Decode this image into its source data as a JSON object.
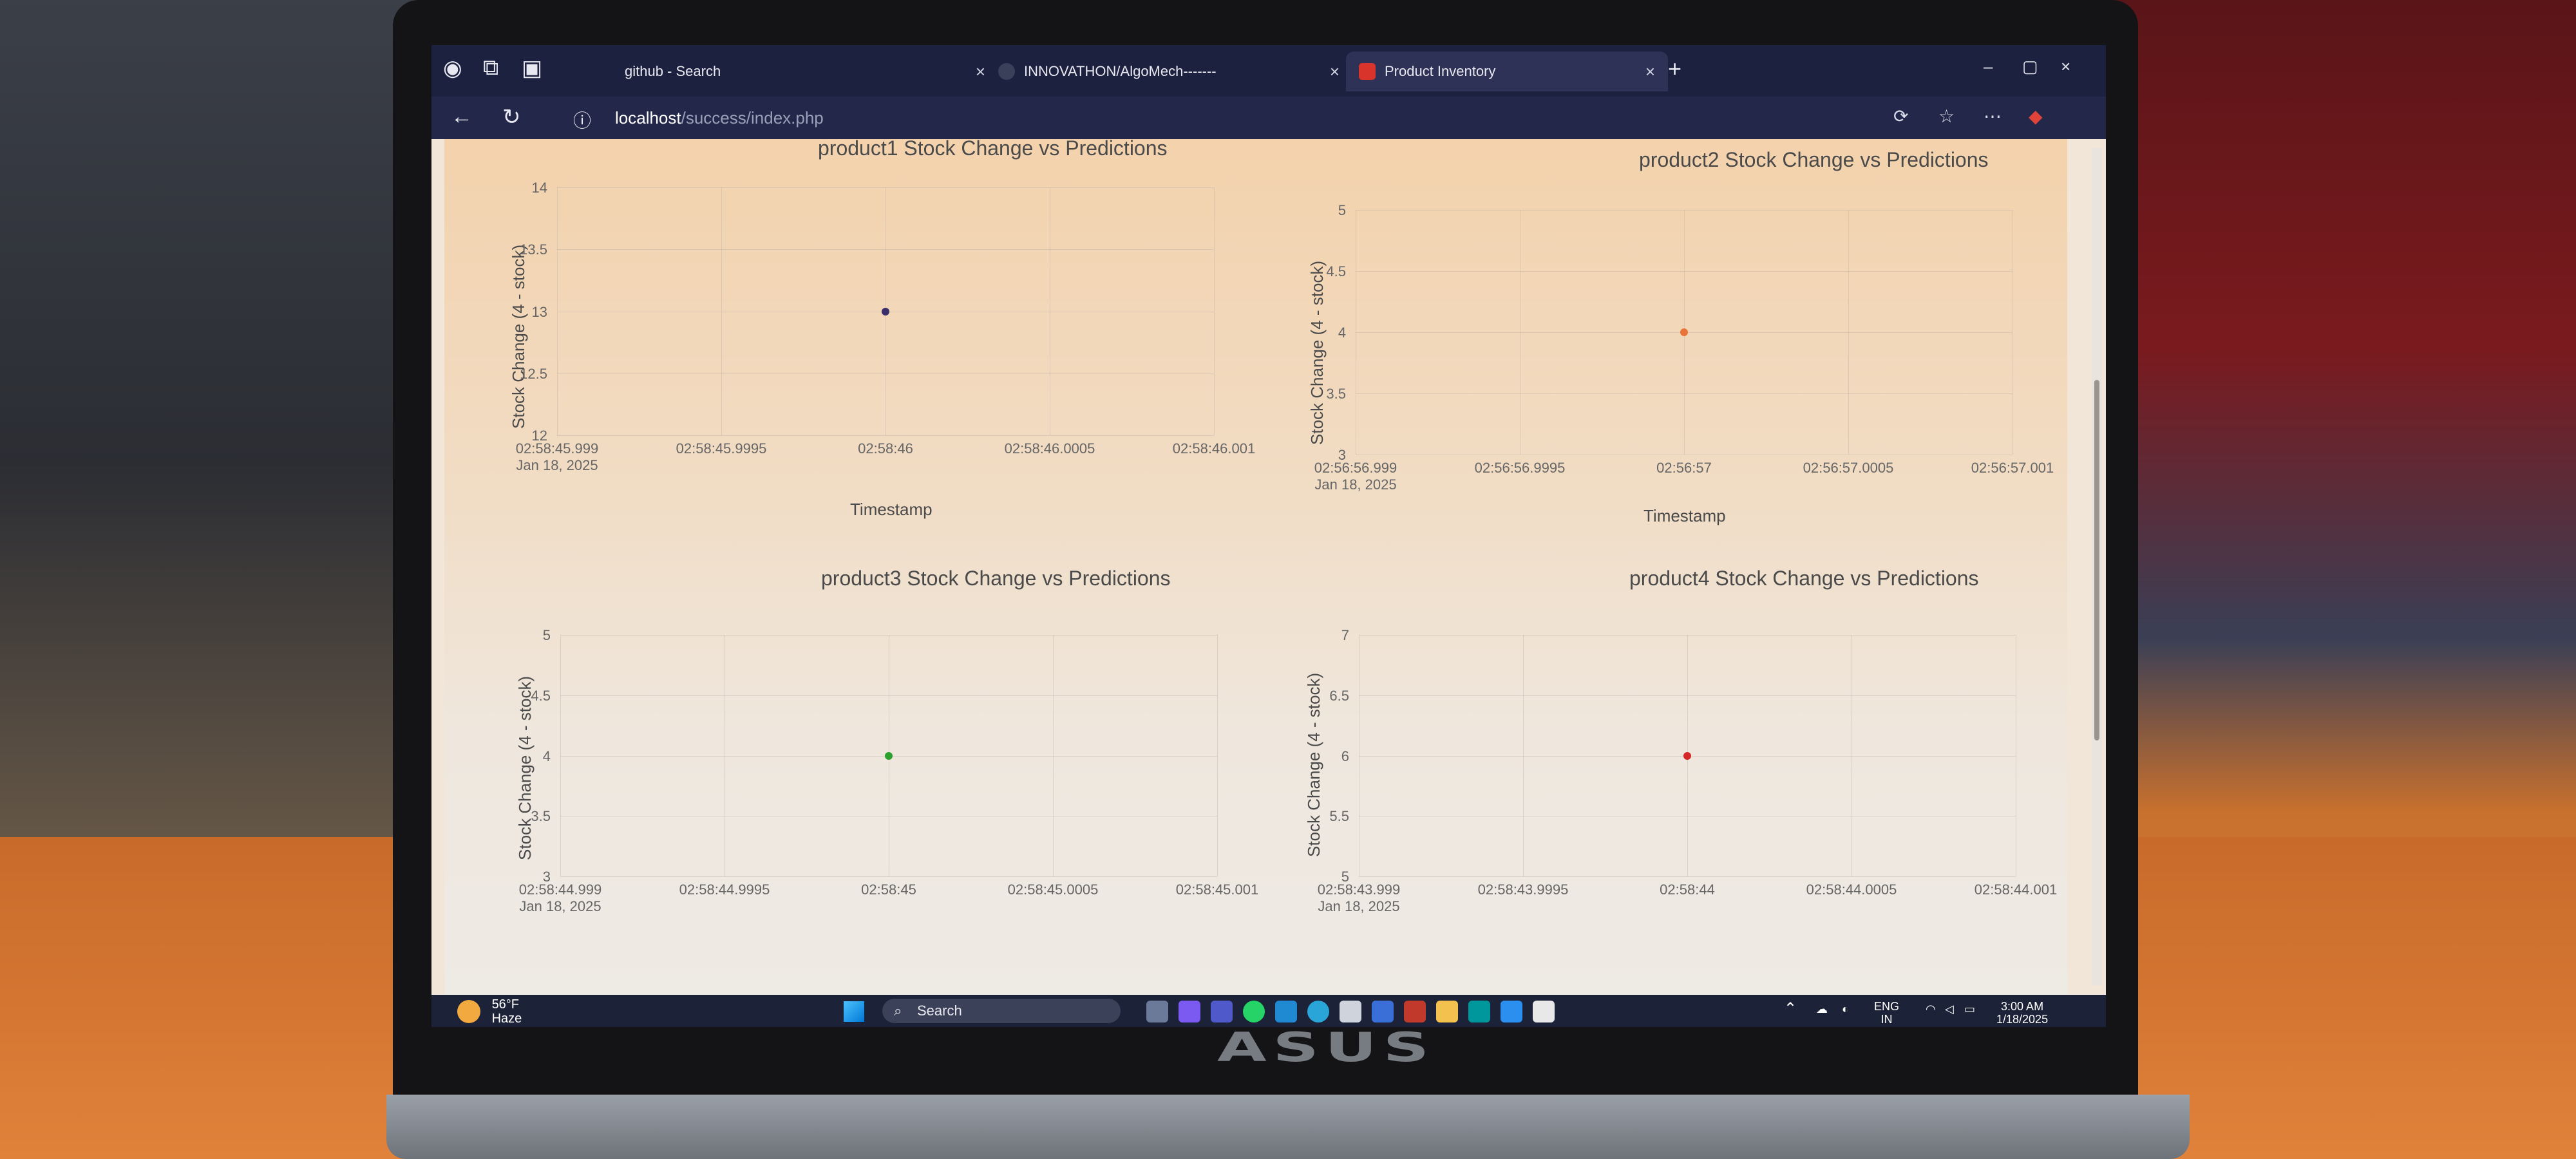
{
  "browser": {
    "tabs": [
      {
        "label": "github - Search",
        "close": "×"
      },
      {
        "label": "INNOVATHON/AlgoMech-------",
        "close": "×"
      },
      {
        "label": "Product Inventory",
        "close": "×"
      }
    ],
    "new_tab": "+",
    "url_host": "localhost",
    "url_path": "/success/index.php",
    "window_controls": [
      "–",
      "▢",
      "×"
    ]
  },
  "taskbar": {
    "weather_temp": "56°F",
    "weather_desc": "Haze",
    "search_label": "Search",
    "lang_top": "ENG",
    "lang_bottom": "IN",
    "time": "3:00 AM",
    "date": "1/18/2025"
  },
  "chart_data": [
    {
      "type": "scatter",
      "title": "product1 Stock Change vs Predictions",
      "xlabel": "Timestamp",
      "ylabel": "Stock Change (4 - stock)",
      "y_ticks": [
        "12",
        "12.5",
        "13",
        "13.5",
        "14"
      ],
      "ylim": [
        12,
        14
      ],
      "x_ticks": [
        {
          "label": "02:58:45.999",
          "sub": "Jan 18, 2025"
        },
        {
          "label": "02:58:45.9995",
          "sub": ""
        },
        {
          "label": "02:58:46",
          "sub": ""
        },
        {
          "label": "02:58:46.0005",
          "sub": ""
        },
        {
          "label": "02:58:46.001",
          "sub": ""
        }
      ],
      "points": [
        {
          "x": "02:58:46",
          "y": 13
        }
      ],
      "marker_color": "#3b2f6b",
      "grid": true
    },
    {
      "type": "scatter",
      "title": "product2 Stock Change vs Predictions",
      "xlabel": "Timestamp",
      "ylabel": "Stock Change (4 - stock)",
      "y_ticks": [
        "3",
        "3.5",
        "4",
        "4.5",
        "5"
      ],
      "ylim": [
        3,
        5
      ],
      "x_ticks": [
        {
          "label": "02:56:56.999",
          "sub": "Jan 18, 2025"
        },
        {
          "label": "02:56:56.9995",
          "sub": ""
        },
        {
          "label": "02:56:57",
          "sub": ""
        },
        {
          "label": "02:56:57.0005",
          "sub": ""
        },
        {
          "label": "02:56:57.001",
          "sub": ""
        }
      ],
      "points": [
        {
          "x": "02:56:57",
          "y": 4
        }
      ],
      "marker_color": "#e8743b",
      "grid": true
    },
    {
      "type": "scatter",
      "title": "product3 Stock Change vs Predictions",
      "xlabel": "",
      "ylabel": "Stock Change (4 - stock)",
      "y_ticks": [
        "3",
        "3.5",
        "4",
        "4.5",
        "5"
      ],
      "ylim": [
        3,
        5
      ],
      "x_ticks": [
        {
          "label": "02:58:44.999",
          "sub": "Jan 18, 2025"
        },
        {
          "label": "02:58:44.9995",
          "sub": ""
        },
        {
          "label": "02:58:45",
          "sub": ""
        },
        {
          "label": "02:58:45.0005",
          "sub": ""
        },
        {
          "label": "02:58:45.001",
          "sub": ""
        }
      ],
      "points": [
        {
          "x": "02:58:45",
          "y": 4
        }
      ],
      "marker_color": "#2ca02c",
      "grid": true
    },
    {
      "type": "scatter",
      "title": "product4 Stock Change vs Predictions",
      "xlabel": "",
      "ylabel": "Stock Change (4 - stock)",
      "y_ticks": [
        "5",
        "5.5",
        "6",
        "6.5",
        "7"
      ],
      "ylim": [
        5,
        7
      ],
      "x_ticks": [
        {
          "label": "02:58:43.999",
          "sub": "Jan 18, 2025"
        },
        {
          "label": "02:58:43.9995",
          "sub": ""
        },
        {
          "label": "02:58:44",
          "sub": ""
        },
        {
          "label": "02:58:44.0005",
          "sub": ""
        },
        {
          "label": "02:58:44.001",
          "sub": ""
        }
      ],
      "points": [
        {
          "x": "02:58:44",
          "y": 6
        }
      ],
      "marker_color": "#d62728",
      "grid": true
    }
  ]
}
